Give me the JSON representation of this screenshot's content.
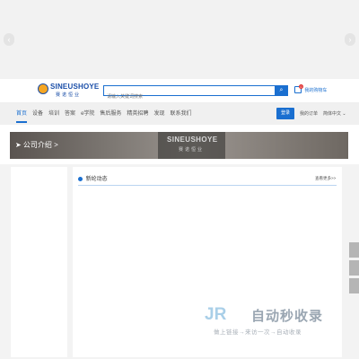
{
  "banner": {
    "prev_arrow": "‹",
    "next_arrow": "›"
  },
  "header": {
    "logo_text": "SINEUSHOYE",
    "logo_subtitle": "赛诺恒业",
    "search_placeholder": "请输入关键词搜索",
    "search_icon": "search-icon",
    "cart_label": "我的购物车",
    "cart_count": "0"
  },
  "nav": {
    "items": [
      {
        "label": "首页"
      },
      {
        "label": "设备"
      },
      {
        "label": "培训"
      },
      {
        "label": "答案"
      },
      {
        "label": "e学院"
      },
      {
        "label": "售后服务"
      },
      {
        "label": "精英招聘"
      },
      {
        "label": "发现"
      },
      {
        "label": "联系我们"
      }
    ],
    "login_label": "登录",
    "orders_label": "我的订单",
    "language_label": "简体中文 ⌄"
  },
  "page_banner": {
    "title": "➤ 公司介绍 >",
    "logo_text": "SINEUSHOYE",
    "logo_subtitle": "赛诺恒业"
  },
  "main": {
    "section_title": "新纶动态",
    "view_more": "查看更多>>"
  },
  "watermark": {
    "mark": "JR",
    "title": "自动秒收录",
    "subtitle": "做上链接→来访一次→自动收录"
  },
  "colors": {
    "accent": "#1a6fd0",
    "nav_bg": "#f0f0f0",
    "page_bg": "#f3f3f3"
  }
}
